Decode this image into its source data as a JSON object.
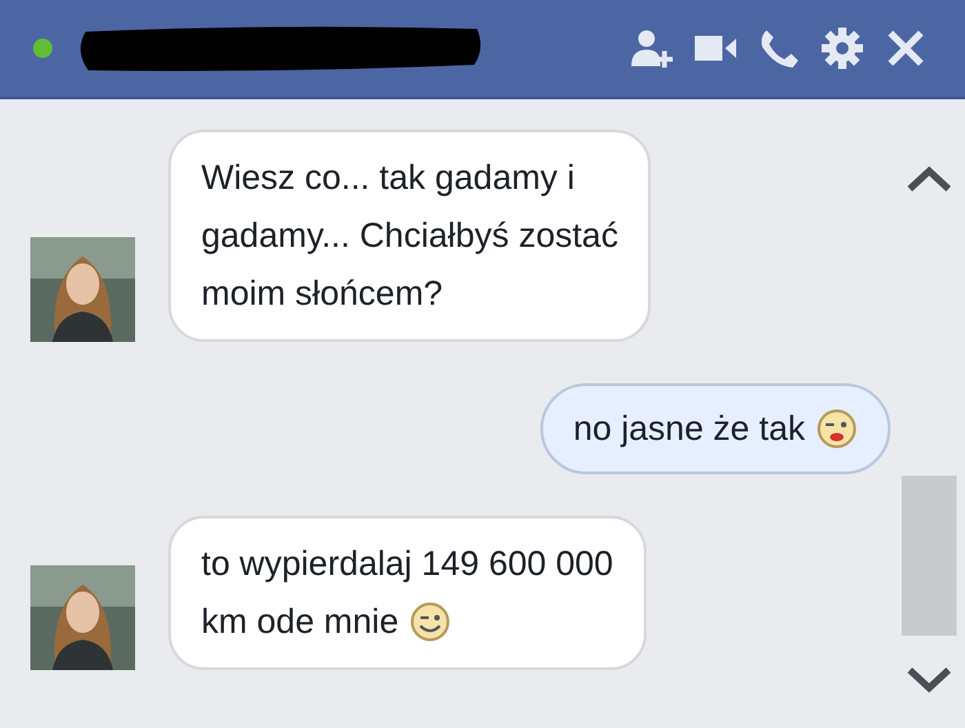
{
  "header": {
    "online": true,
    "name_redacted": true,
    "actions": [
      {
        "kind": "add_person"
      },
      {
        "kind": "video"
      },
      {
        "kind": "call"
      },
      {
        "kind": "settings"
      },
      {
        "kind": "close"
      }
    ]
  },
  "messages": [
    {
      "kind": "incoming",
      "lines": [
        "Wiesz co... tak gadamy i",
        "gadamy... Chciałbyś zostać",
        "moim słońcem?"
      ]
    },
    {
      "kind": "outgoing",
      "lines": [
        "no jasne że tak"
      ],
      "emoticon": {
        "kind": "kiss"
      }
    },
    {
      "kind": "incoming",
      "lines": [
        "to wypierdalaj 149 600 000",
        "km ode mnie"
      ],
      "emoticon": {
        "kind": "wink"
      }
    }
  ]
}
